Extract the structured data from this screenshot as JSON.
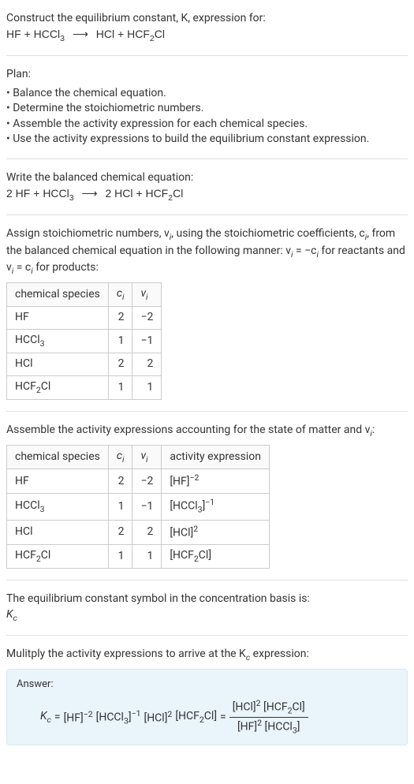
{
  "header": {
    "prompt": "Construct the equilibrium constant, K, expression for:",
    "equation_lhs_a": "HF",
    "equation_lhs_b": "HCCl",
    "equation_lhs_b_sub": "3",
    "arrow": "⟶",
    "equation_rhs_a": "HCl",
    "equation_rhs_b": "HCF",
    "equation_rhs_b_sub": "2",
    "equation_rhs_b_tail": "Cl"
  },
  "plan": {
    "title": "Plan:",
    "items": [
      "Balance the chemical equation.",
      "Determine the stoichiometric numbers.",
      "Assemble the activity expression for each chemical species.",
      "Use the activity expressions to build the equilibrium constant expression."
    ]
  },
  "balanced": {
    "intro": "Write the balanced chemical equation:",
    "c1": "2 HF",
    "plus1": "+",
    "c2": "HCCl",
    "c2_sub": "3",
    "arrow": "⟶",
    "c3": "2 HCl",
    "plus2": "+",
    "c4": "HCF",
    "c4_sub": "2",
    "c4_tail": "Cl"
  },
  "stoich_intro": {
    "text1": "Assign stoichiometric numbers, ν",
    "text1_sub": "i",
    "text2": ", using the stoichiometric coefficients, c",
    "text2_sub": "i",
    "text3": ", from the balanced chemical equation in the following manner: ν",
    "text3_sub": "i",
    "text4": " = −c",
    "text4_sub": "i",
    "text5": " for reactants and ν",
    "text5_sub": "i",
    "text6": " = c",
    "text6_sub": "i",
    "text7": " for products:"
  },
  "table1": {
    "headers": {
      "h1": "chemical species",
      "h2": "c",
      "h2_sub": "i",
      "h3": "ν",
      "h3_sub": "i"
    },
    "rows": [
      {
        "sp": "HF",
        "sp_sub": "",
        "sp_tail": "",
        "c": "2",
        "v": "−2"
      },
      {
        "sp": "HCCl",
        "sp_sub": "3",
        "sp_tail": "",
        "c": "1",
        "v": "−1"
      },
      {
        "sp": "HCl",
        "sp_sub": "",
        "sp_tail": "",
        "c": "2",
        "v": "2"
      },
      {
        "sp": "HCF",
        "sp_sub": "2",
        "sp_tail": "Cl",
        "c": "1",
        "v": "1"
      }
    ]
  },
  "activity_intro": {
    "text1": "Assemble the activity expressions accounting for the state of matter and ν",
    "sub": "i",
    "text2": ":"
  },
  "table2": {
    "headers": {
      "h1": "chemical species",
      "h2": "c",
      "h2_sub": "i",
      "h3": "ν",
      "h3_sub": "i",
      "h4": "activity expression"
    },
    "rows": [
      {
        "sp": "HF",
        "sp_sub": "",
        "sp_tail": "",
        "c": "2",
        "v": "−2",
        "ae_open": "[HF]",
        "ae_sup": "−2",
        "ae_tail": ""
      },
      {
        "sp": "HCCl",
        "sp_sub": "3",
        "sp_tail": "",
        "c": "1",
        "v": "−1",
        "ae_open": "[HCCl",
        "ae_sub": "3",
        "ae_close": "]",
        "ae_sup": "−1",
        "ae_tail": ""
      },
      {
        "sp": "HCl",
        "sp_sub": "",
        "sp_tail": "",
        "c": "2",
        "v": "2",
        "ae_open": "[HCl]",
        "ae_sup": "2",
        "ae_tail": ""
      },
      {
        "sp": "HCF",
        "sp_sub": "2",
        "sp_tail": "Cl",
        "c": "1",
        "v": "1",
        "ae_open": "[HCF",
        "ae_sub": "2",
        "ae_close": "Cl]",
        "ae_sup": "",
        "ae_tail": ""
      }
    ]
  },
  "basis": {
    "line1": "The equilibrium constant symbol in the concentration basis is:",
    "sym": "K",
    "sym_sub": "c"
  },
  "mult": {
    "line": "Mulitply the activity expressions to arrive at the K",
    "sub": "c",
    "tail": " expression:"
  },
  "answer": {
    "label": "Answer:",
    "kc": "K",
    "kc_sub": "c",
    "eq": " = ",
    "t1": "[HF]",
    "t1_sup": "−2",
    "t2": " [HCCl",
    "t2_sub": "3",
    "t2_close": "]",
    "t2_sup": "−1",
    "t3": " [HCl]",
    "t3_sup": "2",
    "t4": " [HCF",
    "t4_sub": "2",
    "t4_close": "Cl]",
    "eq2": " = ",
    "num_a": "[HCl]",
    "num_a_sup": "2",
    "num_b": " [HCF",
    "num_b_sub": "2",
    "num_b_close": "Cl]",
    "den_a": "[HF]",
    "den_a_sup": "2",
    "den_b": " [HCCl",
    "den_b_sub": "3",
    "den_b_close": "]"
  }
}
